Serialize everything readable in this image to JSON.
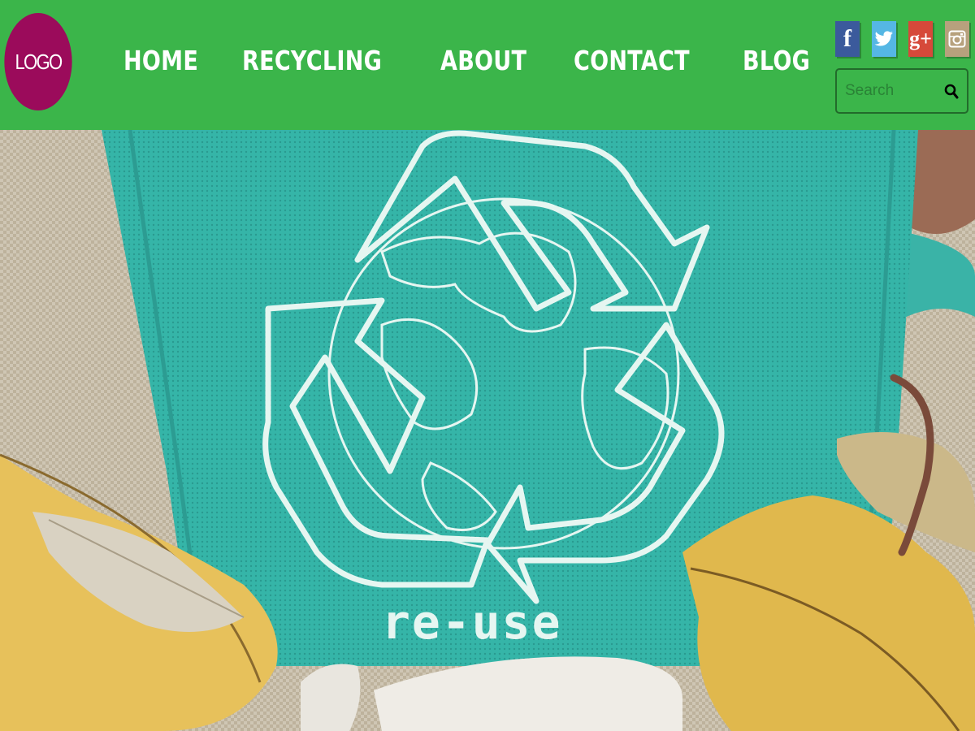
{
  "header": {
    "logo_text": "LOGO",
    "background_color": "#3bb54a",
    "logo_color": "#9b0b5b",
    "nav": [
      {
        "label": "HOME"
      },
      {
        "label": "RECYCLING"
      },
      {
        "label": "ABOUT"
      },
      {
        "label": "CONTACT"
      },
      {
        "label": "BLOG"
      }
    ],
    "social": [
      {
        "name": "facebook-icon",
        "glyph": "f"
      },
      {
        "name": "twitter-icon",
        "glyph": ""
      },
      {
        "name": "google-plus-icon",
        "glyph": "g+"
      },
      {
        "name": "instagram-icon",
        "glyph": ""
      }
    ],
    "search": {
      "placeholder": "Search",
      "value": ""
    }
  },
  "hero": {
    "caption": "re-use",
    "bag_color": "#33b3a6"
  }
}
